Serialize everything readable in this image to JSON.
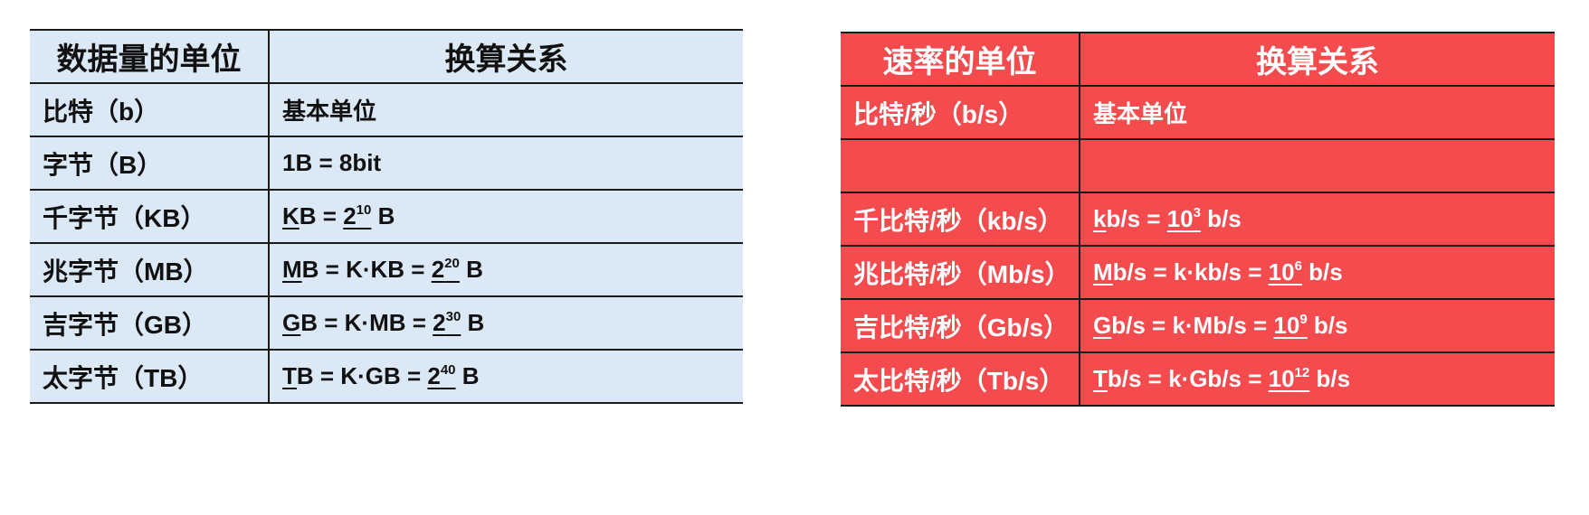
{
  "data_table": {
    "headers": [
      "数据量的单位",
      "换算关系"
    ],
    "rows": [
      {
        "unit": "比特（b）",
        "f": [
          "基本单位"
        ]
      },
      {
        "unit": "字节（B）",
        "f": [
          "1B = 8bit"
        ]
      },
      {
        "unit": "千字节（KB）",
        "f": [
          "K",
          "B = ",
          "2",
          "10",
          " B"
        ]
      },
      {
        "unit": "兆字节（MB）",
        "f": [
          "M",
          "B = K·KB = ",
          "2",
          "20",
          " B"
        ]
      },
      {
        "unit": "吉字节（GB）",
        "f": [
          "G",
          "B = K·MB = ",
          "2",
          "30",
          " B"
        ]
      },
      {
        "unit": "太字节（TB）",
        "f": [
          "T",
          "B = K·GB = ",
          "2",
          "40",
          " B"
        ]
      }
    ]
  },
  "rate_table": {
    "headers": [
      "速率的单位",
      "换算关系"
    ],
    "rows": [
      {
        "unit": "比特/秒（b/s）",
        "f": [
          "基本单位"
        ]
      },
      {
        "unit": "",
        "f": [
          ""
        ]
      },
      {
        "unit": "千比特/秒（kb/s）",
        "f": [
          "k",
          "b/s = ",
          "10",
          "3",
          " b/s"
        ]
      },
      {
        "unit": "兆比特/秒（Mb/s）",
        "f": [
          "M",
          "b/s = k·kb/s = ",
          "10",
          "6",
          " b/s"
        ]
      },
      {
        "unit": "吉比特/秒（Gb/s）",
        "f": [
          "G",
          "b/s = k·Mb/s = ",
          "10",
          "9",
          " b/s"
        ]
      },
      {
        "unit": "太比特/秒（Tb/s）",
        "f": [
          "T",
          "b/s = k·Gb/s = ",
          "10",
          "12",
          " b/s"
        ]
      }
    ]
  },
  "colors": {
    "data_table_bg": "#dbe9f7",
    "rate_table_bg": "#f44b4e",
    "rate_table_text": "#ffffff"
  }
}
